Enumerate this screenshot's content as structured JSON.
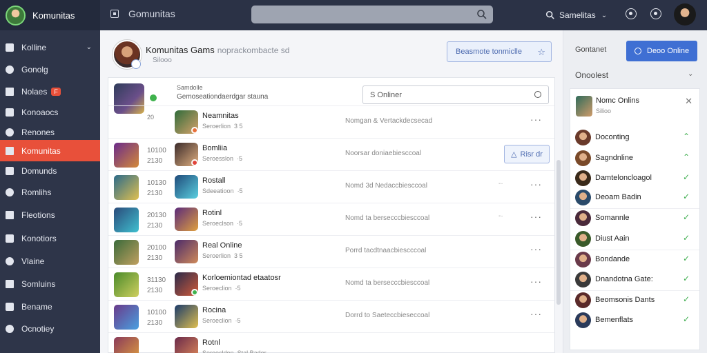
{
  "app": {
    "brand": "Komunitas",
    "window_title": "Gomunitas",
    "search_icon": "search-icon",
    "user_menu": "Samelitas"
  },
  "sidebar": {
    "items": [
      {
        "label": "Kolline",
        "icon": "home-icon",
        "active": false,
        "chevron": true
      },
      {
        "label": "Gonolg",
        "icon": "person-icon",
        "active": false
      },
      {
        "label": "Nolaes",
        "icon": "chat-icon",
        "active": false,
        "badge": "F"
      },
      {
        "label": "Konoaocs",
        "icon": "search-icon",
        "active": false
      },
      {
        "label": "Renones",
        "icon": "mail-icon",
        "active": false
      },
      {
        "label": "Komunitas",
        "icon": "tag-icon",
        "active": true
      },
      {
        "label": "Domunds",
        "icon": "group-icon",
        "active": false
      },
      {
        "label": "Romlihs",
        "icon": "image-icon",
        "active": false
      },
      {
        "label": "Fleotions",
        "icon": "star-icon",
        "active": false
      },
      {
        "label": "Konotiors",
        "icon": "lock-icon",
        "active": false
      },
      {
        "label": "Vlaine",
        "icon": "settings-icon",
        "active": false
      },
      {
        "label": "Somluins",
        "icon": "list-icon",
        "active": false
      },
      {
        "label": "Bename",
        "icon": "bookmark-icon",
        "active": false
      },
      {
        "label": "Ocnotiey",
        "icon": "gear-icon",
        "active": false
      }
    ]
  },
  "profile": {
    "title": "Komunitas Gams",
    "subtitle": "noprackombacte sd",
    "meta": "Silooo",
    "follow_button": "Beasmote tonmiclle"
  },
  "card": {
    "head_line1": "Samdolle",
    "head_line2": "Gemoseationdaerdgar stauna",
    "head_num": "20",
    "search_placeholder": "S Onliner"
  },
  "rows": [
    {
      "time": "",
      "name": "Neamnitas",
      "sub": "Seroerlion",
      "sub2": "3 5",
      "status": "Nomgan & Vertackdecsecad",
      "action": "dots",
      "dot": "#e8703a"
    },
    {
      "time1": "10100",
      "time2": "2130",
      "name": "Bomliia",
      "sub": "Seroesslon",
      "sub2": "·5",
      "status": "Noorsar doniaebiesccoal",
      "action": "button",
      "button_label": "Risr dr",
      "dot": "#e0443a"
    },
    {
      "time1": "10130",
      "time2": "2130",
      "name": "Rostall",
      "sub": "Sdeeatioon",
      "sub2": "·5",
      "status": "Nomd 3d Nedaccbiesccoal",
      "action": "dots",
      "dash": "-·"
    },
    {
      "time1": "20130",
      "time2": "2130",
      "name": "Rotinl",
      "sub": "Seroeclson",
      "sub2": "·5",
      "status": "Nomd ta bersecccbiesccoal",
      "action": "dots",
      "dash": "-·"
    },
    {
      "time1": "20100",
      "time2": "2130",
      "name": "Real Online",
      "sub": "Seroerlion",
      "sub2": "3 5",
      "status": "Porrd tacdtnaacbiescccoal",
      "action": "dots"
    },
    {
      "time1": "31130",
      "time2": "2130",
      "name": "Korloemiontad etaatosr",
      "sub": "Seroeclion",
      "sub2": "·5",
      "status": "Nomd ta bersecccbiesccoal",
      "action": "dots",
      "dot": "#3fb24d"
    },
    {
      "time1": "10100",
      "time2": "2130",
      "name": "Rocina",
      "sub": "Seroeclion",
      "sub2": "·5",
      "status": "Dorrd to Saeteccbieseccoal",
      "action": "dots"
    },
    {
      "time1": "",
      "time2": "",
      "name": "Rotnl",
      "sub": "Seroecldon",
      "sub2": "Stal Bader",
      "status": "",
      "action": "none"
    }
  ],
  "right": {
    "contact_label": "Gontanet",
    "online_button": "Deoo Online",
    "section_label": "Onoolest",
    "head_name": "Nomc Onlins",
    "head_sub": "Silioo",
    "friends": [
      {
        "name": "Doconting",
        "check": "up"
      },
      {
        "name": "Sagndnline",
        "check": "up"
      },
      {
        "name": "Damteloncloagol",
        "check": "down"
      },
      {
        "name": "Deoam Badin",
        "check": "down"
      },
      {
        "name": "Somannle",
        "check": "down"
      },
      {
        "name": "Diust Aain",
        "check": "down"
      },
      {
        "name": "Bondande",
        "check": "down"
      },
      {
        "name": "Dnandotna Gate:",
        "check": "down"
      },
      {
        "name": "Beomsonis Dants",
        "check": "down"
      },
      {
        "name": "Bemenflats",
        "check": "down"
      }
    ]
  },
  "colors": {
    "topbar": "#2b3246",
    "sidebar": "#2e3549",
    "active": "#e8503a",
    "accent": "#3f6fd3",
    "check": "#3fae4f"
  }
}
